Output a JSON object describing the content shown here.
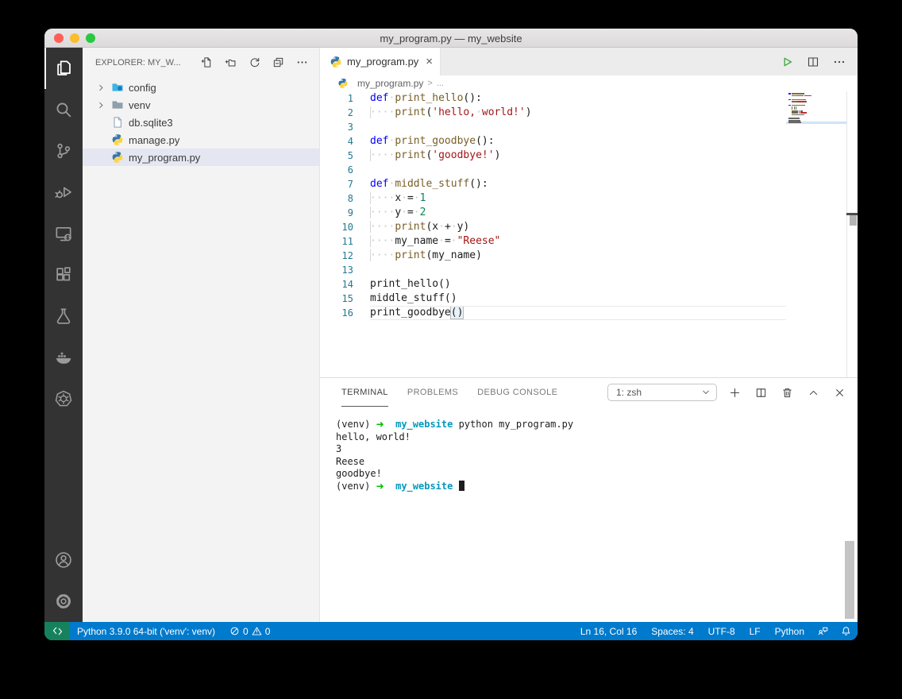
{
  "window": {
    "title": "my_program.py — my_website"
  },
  "colors": {
    "status_bar_bg": "#007acc",
    "remote_bg": "#16825d",
    "activity_bar_bg": "#333333",
    "sidebar_bg": "#f3f3f3",
    "list_selection_bg": "#e4e6f1",
    "traffic_lights": [
      "#ff5f57",
      "#febc2e",
      "#28c840"
    ],
    "token": {
      "kw": "#0000ff",
      "fn": "#795e26",
      "str": "#a31515",
      "num": "#098658",
      "txt": "#1b1b1b",
      "ws": "#c9c9c9",
      "brk": "#1b1b1b"
    },
    "terminal": {
      "green": "#00bc00",
      "cyan": "#0598bc",
      "text": "#1e1e1e"
    },
    "line_number": "#237893",
    "run_button": "#3fa73f"
  },
  "activity_bar": {
    "top": [
      {
        "name": "explorer",
        "active": true
      },
      {
        "name": "search",
        "active": false
      },
      {
        "name": "source-control",
        "active": false
      },
      {
        "name": "run-debug",
        "active": false
      },
      {
        "name": "remote-explorer",
        "active": false
      },
      {
        "name": "extensions",
        "active": false
      },
      {
        "name": "testing",
        "active": false
      },
      {
        "name": "docker",
        "active": false
      },
      {
        "name": "kubernetes",
        "active": false
      }
    ],
    "bottom": [
      {
        "name": "account",
        "active": false
      },
      {
        "name": "settings",
        "active": false
      }
    ]
  },
  "sidebar": {
    "header": "EXPLORER: MY_W...",
    "actions": [
      "new-file",
      "new-folder",
      "refresh",
      "collapse-all",
      "more"
    ],
    "files": [
      {
        "label": "config",
        "icon": "folder-config",
        "chevron": true,
        "selected": false
      },
      {
        "label": "venv",
        "icon": "folder",
        "chevron": true,
        "selected": false
      },
      {
        "label": "db.sqlite3",
        "icon": "file",
        "chevron": false,
        "selected": false
      },
      {
        "label": "manage.py",
        "icon": "python",
        "chevron": false,
        "selected": false
      },
      {
        "label": "my_program.py",
        "icon": "python",
        "chevron": false,
        "selected": true
      }
    ]
  },
  "editor": {
    "tab": {
      "label": "my_program.py",
      "icon": "python",
      "close_glyph": "×"
    },
    "actions": [
      "run",
      "split-editor",
      "more"
    ],
    "breadcrumb": {
      "file": "my_program.py",
      "separator": ">",
      "tail": "..."
    },
    "code": {
      "lines": [
        {
          "n": "1",
          "guide": false,
          "current": false,
          "tokens": [
            [
              "kw",
              "def"
            ],
            [
              "ws",
              "·"
            ],
            [
              "fn",
              "print_hello"
            ],
            [
              "txt",
              "():"
            ]
          ]
        },
        {
          "n": "2",
          "guide": true,
          "current": false,
          "tokens": [
            [
              "ws",
              "····"
            ],
            [
              "fn",
              "print"
            ],
            [
              "txt",
              "("
            ],
            [
              "str",
              "'hello,"
            ],
            [
              "ws",
              "·"
            ],
            [
              "str",
              "world!'"
            ],
            [
              "txt",
              ")"
            ]
          ]
        },
        {
          "n": "3",
          "guide": false,
          "current": false,
          "tokens": []
        },
        {
          "n": "4",
          "guide": false,
          "current": false,
          "tokens": [
            [
              "kw",
              "def"
            ],
            [
              "ws",
              "·"
            ],
            [
              "fn",
              "print_goodbye"
            ],
            [
              "txt",
              "():"
            ]
          ]
        },
        {
          "n": "5",
          "guide": true,
          "current": false,
          "tokens": [
            [
              "ws",
              "····"
            ],
            [
              "fn",
              "print"
            ],
            [
              "txt",
              "("
            ],
            [
              "str",
              "'goodbye!'"
            ],
            [
              "txt",
              ")"
            ]
          ]
        },
        {
          "n": "6",
          "guide": false,
          "current": false,
          "tokens": []
        },
        {
          "n": "7",
          "guide": false,
          "current": false,
          "tokens": [
            [
              "kw",
              "def"
            ],
            [
              "ws",
              "·"
            ],
            [
              "fn",
              "middle_stuff"
            ],
            [
              "txt",
              "():"
            ]
          ]
        },
        {
          "n": "8",
          "guide": true,
          "current": false,
          "tokens": [
            [
              "ws",
              "····"
            ],
            [
              "txt",
              "x"
            ],
            [
              "ws",
              "·"
            ],
            [
              "txt",
              "="
            ],
            [
              "ws",
              "·"
            ],
            [
              "num",
              "1"
            ]
          ]
        },
        {
          "n": "9",
          "guide": true,
          "current": false,
          "tokens": [
            [
              "ws",
              "····"
            ],
            [
              "txt",
              "y"
            ],
            [
              "ws",
              "·"
            ],
            [
              "txt",
              "="
            ],
            [
              "ws",
              "·"
            ],
            [
              "num",
              "2"
            ]
          ]
        },
        {
          "n": "10",
          "guide": true,
          "current": false,
          "tokens": [
            [
              "ws",
              "····"
            ],
            [
              "fn",
              "print"
            ],
            [
              "txt",
              "(x"
            ],
            [
              "ws",
              "·"
            ],
            [
              "txt",
              "+"
            ],
            [
              "ws",
              "·"
            ],
            [
              "txt",
              "y)"
            ]
          ]
        },
        {
          "n": "11",
          "guide": true,
          "current": false,
          "tokens": [
            [
              "ws",
              "····"
            ],
            [
              "txt",
              "my_name"
            ],
            [
              "ws",
              "·"
            ],
            [
              "txt",
              "="
            ],
            [
              "ws",
              "·"
            ],
            [
              "str",
              "\"Reese\""
            ]
          ]
        },
        {
          "n": "12",
          "guide": true,
          "current": false,
          "tokens": [
            [
              "ws",
              "····"
            ],
            [
              "fn",
              "print"
            ],
            [
              "txt",
              "(my_name)"
            ]
          ]
        },
        {
          "n": "13",
          "guide": false,
          "current": false,
          "tokens": []
        },
        {
          "n": "14",
          "guide": false,
          "current": false,
          "tokens": [
            [
              "txt",
              "print_hello()"
            ]
          ]
        },
        {
          "n": "15",
          "guide": false,
          "current": false,
          "tokens": [
            [
              "txt",
              "middle_stuff()"
            ]
          ]
        },
        {
          "n": "16",
          "guide": false,
          "current": true,
          "tokens": [
            [
              "txt",
              "print_goodbye"
            ],
            [
              "brk",
              "()"
            ]
          ]
        }
      ]
    }
  },
  "panel": {
    "tabs": [
      {
        "label": "TERMINAL",
        "active": true
      },
      {
        "label": "PROBLEMS",
        "active": false
      },
      {
        "label": "DEBUG CONSOLE",
        "active": false
      }
    ],
    "terminal_dropdown": {
      "value": "1: zsh"
    },
    "actions": [
      "new-terminal",
      "split-terminal",
      "kill-terminal",
      "maximize-panel",
      "close-panel"
    ],
    "terminal": {
      "lines": [
        [
          [
            "plain",
            "(venv) "
          ],
          [
            "green",
            "➜"
          ],
          [
            "plain",
            "  "
          ],
          [
            "cyan",
            "my_website"
          ],
          [
            "plain",
            " python my_program.py"
          ]
        ],
        [
          [
            "plain",
            "hello, world!"
          ]
        ],
        [
          [
            "plain",
            "3"
          ]
        ],
        [
          [
            "plain",
            "Reese"
          ]
        ],
        [
          [
            "plain",
            "goodbye!"
          ]
        ],
        [
          [
            "plain",
            "(venv) "
          ],
          [
            "green",
            "➜"
          ],
          [
            "plain",
            "  "
          ],
          [
            "cyan",
            "my_website"
          ],
          [
            "plain",
            " "
          ],
          [
            "cursor",
            ""
          ]
        ]
      ]
    }
  },
  "status_bar": {
    "python_version": "Python 3.9.0 64-bit ('venv': venv)",
    "errors": "0",
    "warnings": "0",
    "right": [
      {
        "label": "Ln 16, Col 16"
      },
      {
        "label": "Spaces: 4"
      },
      {
        "label": "UTF-8"
      },
      {
        "label": "LF"
      },
      {
        "label": "Python"
      }
    ]
  }
}
